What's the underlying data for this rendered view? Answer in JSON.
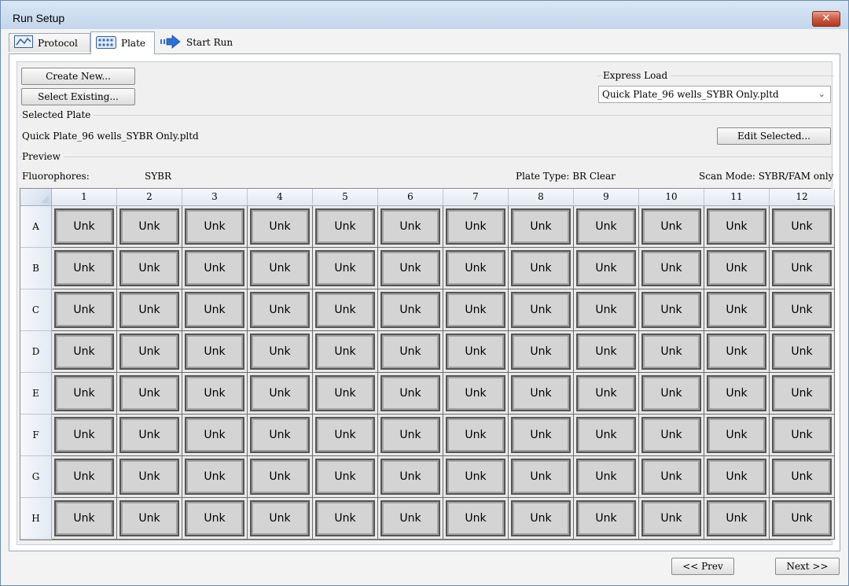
{
  "window": {
    "title": "Run Setup",
    "close_glyph": "✕"
  },
  "tabs": [
    {
      "label": "Protocol",
      "icon": "protocol-icon"
    },
    {
      "label": "Plate",
      "icon": "plate-grid-icon",
      "active": true
    },
    {
      "label": "Start Run",
      "icon": "start-run-arrow-icon"
    }
  ],
  "buttons": {
    "create_new": "Create New...",
    "select_existing": "Select Existing...",
    "edit_selected": "Edit Selected...",
    "prev": "<< Prev",
    "next": "Next >>"
  },
  "express_load": {
    "label": "Express Load",
    "value": "Quick Plate_96 wells_SYBR Only.pltd"
  },
  "selected_plate": {
    "label": "Selected Plate",
    "filename": "Quick Plate_96 wells_SYBR Only.pltd"
  },
  "preview": {
    "label": "Preview",
    "fluorophores_label": "Fluorophores:",
    "fluorophores_value": "SYBR",
    "plate_type": "Plate Type: BR Clear",
    "scan_mode": "Scan Mode: SYBR/FAM only"
  },
  "plate": {
    "columns": [
      "1",
      "2",
      "3",
      "4",
      "5",
      "6",
      "7",
      "8",
      "9",
      "10",
      "11",
      "12"
    ],
    "rows": [
      "A",
      "B",
      "C",
      "D",
      "E",
      "F",
      "G",
      "H"
    ],
    "well_label": "Unk"
  }
}
